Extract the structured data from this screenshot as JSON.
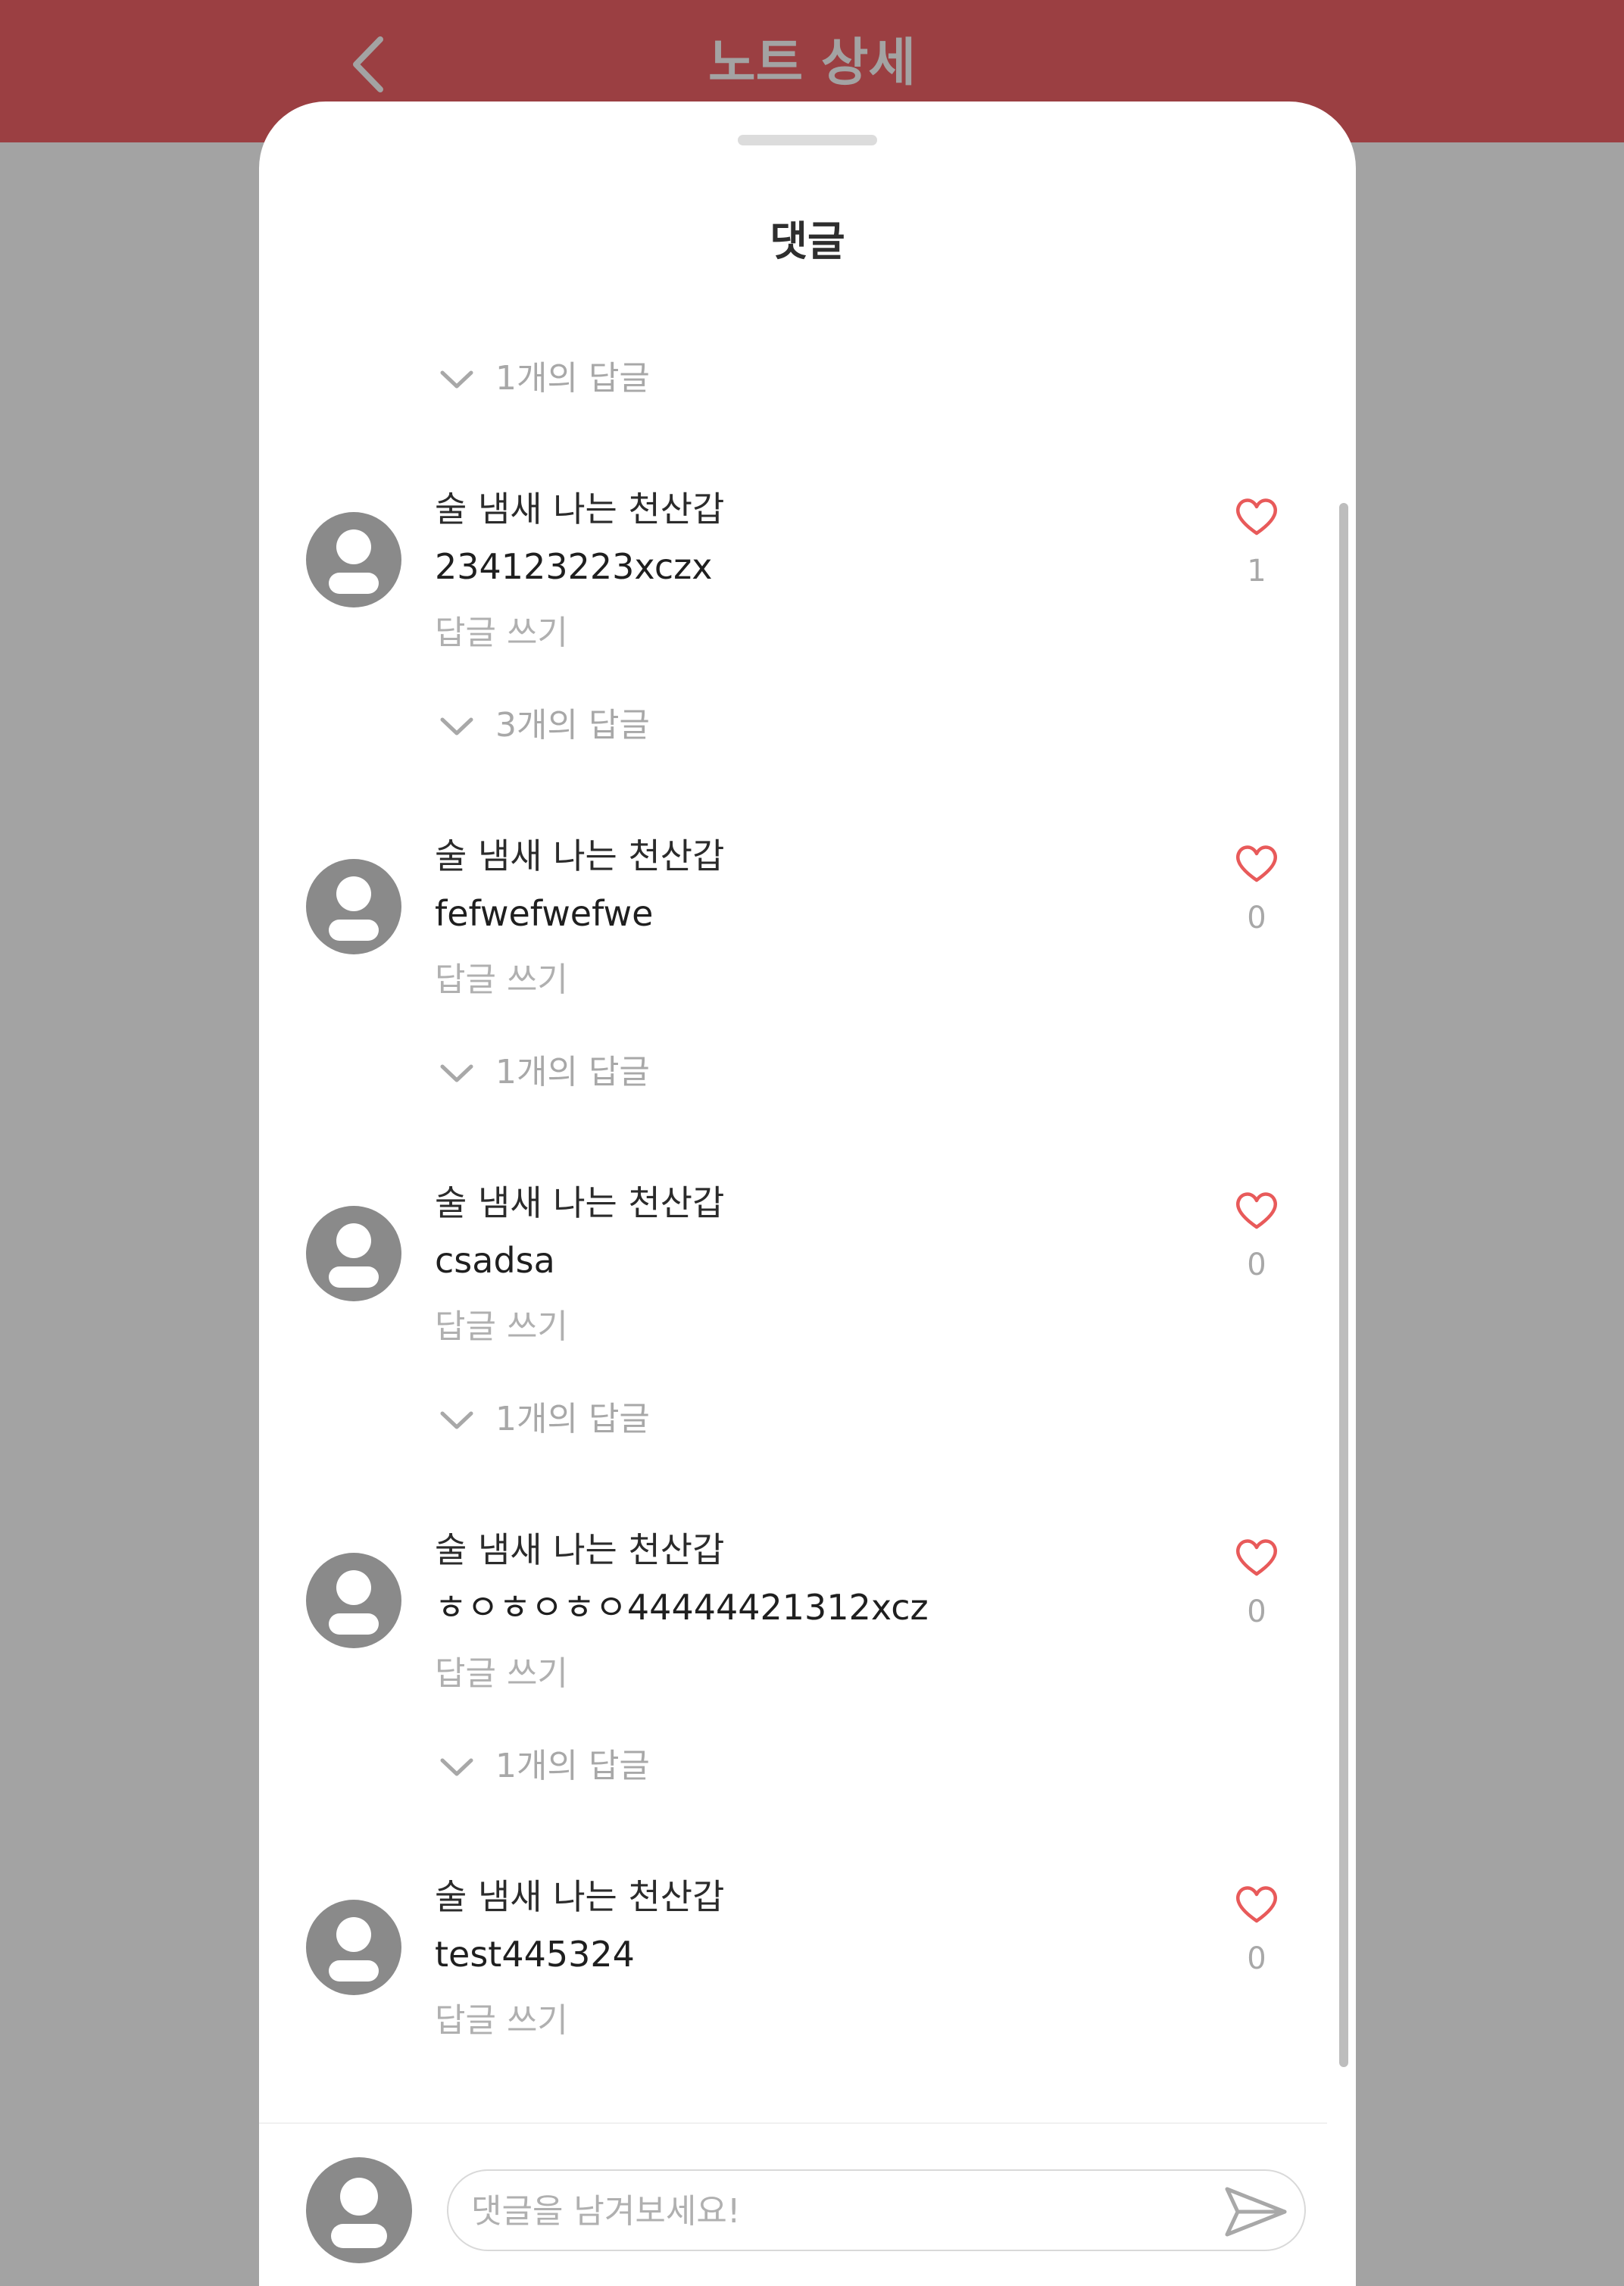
{
  "header": {
    "title": "노트 상세",
    "back_icon": "chevron-left-icon",
    "background_color": "#9b3f42"
  },
  "sheet": {
    "title": "댓글"
  },
  "top_reply_toggle": {
    "label": "1개의 답글",
    "icon": "chevron-down-icon"
  },
  "comments": [
    {
      "author": "술 냄새 나는 천산갑",
      "text": "234123223xczx",
      "reply_label": "답글 쓰기",
      "likes": "1",
      "replies_label": "3개의 답글"
    },
    {
      "author": "술 냄새 나는 천산갑",
      "text": "fefwefwefwe",
      "reply_label": "답글 쓰기",
      "likes": "0",
      "replies_label": "1개의 답글"
    },
    {
      "author": "술 냄새 나는 천산갑",
      "text": "csadsa",
      "reply_label": "답글 쓰기",
      "likes": "0",
      "replies_label": "1개의 답글"
    },
    {
      "author": "술 냄새 나는 천산갑",
      "text": "ㅎㅇㅎㅇㅎㅇ44444421312xcz",
      "reply_label": "답글 쓰기",
      "likes": "0",
      "replies_label": "1개의 답글"
    },
    {
      "author": "술 냄새 나는 천산갑",
      "text": "test445324",
      "reply_label": "답글 쓰기",
      "likes": "0"
    }
  ],
  "input": {
    "placeholder": "댓글을 남겨보세요!",
    "value": "",
    "send_icon": "send-icon"
  },
  "colors": {
    "accent": "#9b3f42",
    "heart": "#e85a5a",
    "avatar": "#8a8a8a",
    "muted_text": "#a8a8a8"
  }
}
